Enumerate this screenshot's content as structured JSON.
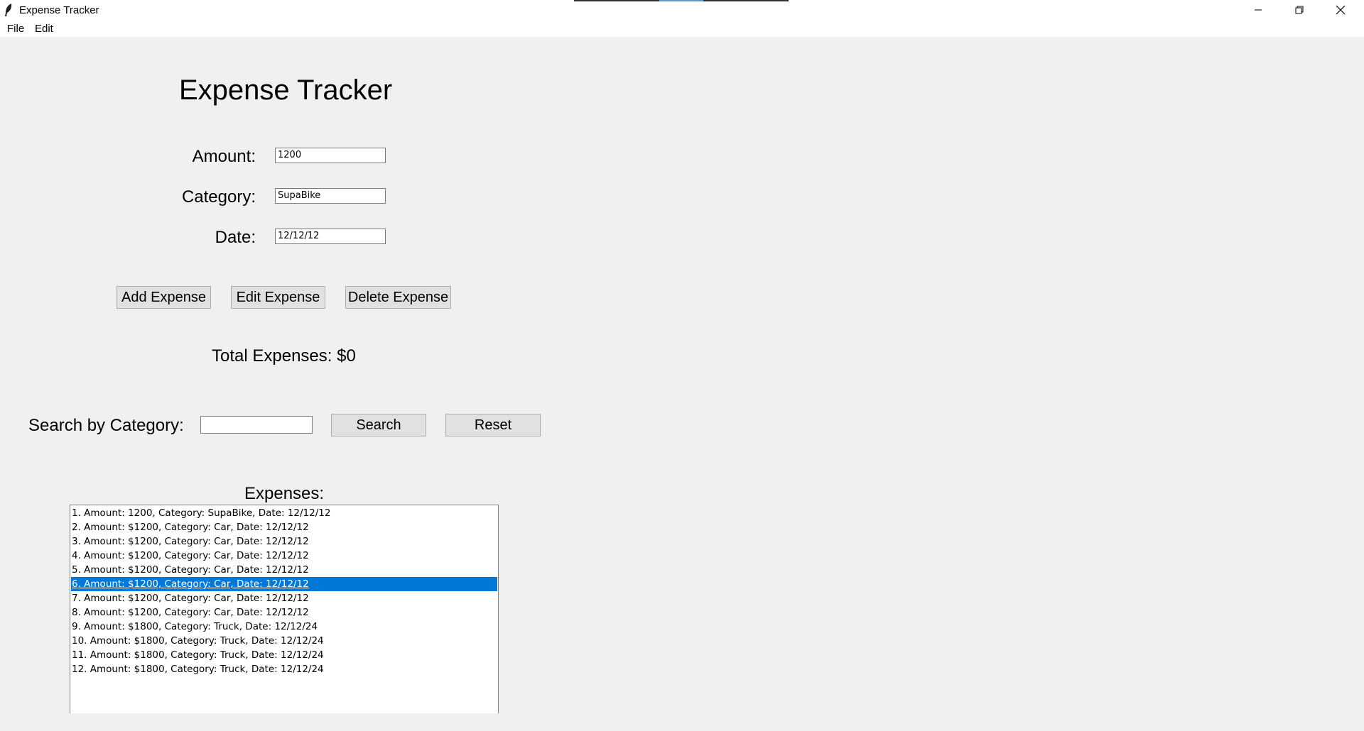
{
  "window": {
    "title": "Expense Tracker"
  },
  "menu": {
    "items": [
      "File",
      "Edit"
    ]
  },
  "app": {
    "heading": "Expense Tracker",
    "fields": [
      {
        "label": "Amount:",
        "value": "1200"
      },
      {
        "label": "Category:",
        "value": "SupaBike"
      },
      {
        "label": "Date:",
        "value": "12/12/12"
      }
    ],
    "buttons": {
      "add": "Add Expense",
      "edit": "Edit Expense",
      "delete": "Delete Expense"
    },
    "total": "Total Expenses: $0",
    "search": {
      "label": "Search by Category:",
      "value": "",
      "search_button": "Search",
      "reset_button": "Reset"
    },
    "list_label": "Expenses:",
    "selected_index": 5,
    "expenses": [
      "1. Amount: 1200, Category: SupaBike, Date: 12/12/12",
      "2. Amount: $1200, Category: Car, Date: 12/12/12",
      "3. Amount: $1200, Category: Car, Date: 12/12/12",
      "4. Amount: $1200, Category: Car, Date: 12/12/12",
      "5. Amount: $1200, Category: Car, Date: 12/12/12",
      "6. Amount: $1200, Category: Car, Date: 12/12/12",
      "7. Amount: $1200, Category: Car, Date: 12/12/12",
      "8. Amount: $1200, Category: Car, Date: 12/12/12",
      "9. Amount: $1800, Category: Truck, Date: 12/12/24",
      "10. Amount: $1800, Category: Truck, Date: 12/12/24",
      "11. Amount: $1800, Category: Truck, Date: 12/12/24",
      "12. Amount: $1800, Category: Truck, Date: 12/12/24"
    ]
  },
  "colors": {
    "selection": "#0078d7",
    "background": "#f0f0f0"
  }
}
